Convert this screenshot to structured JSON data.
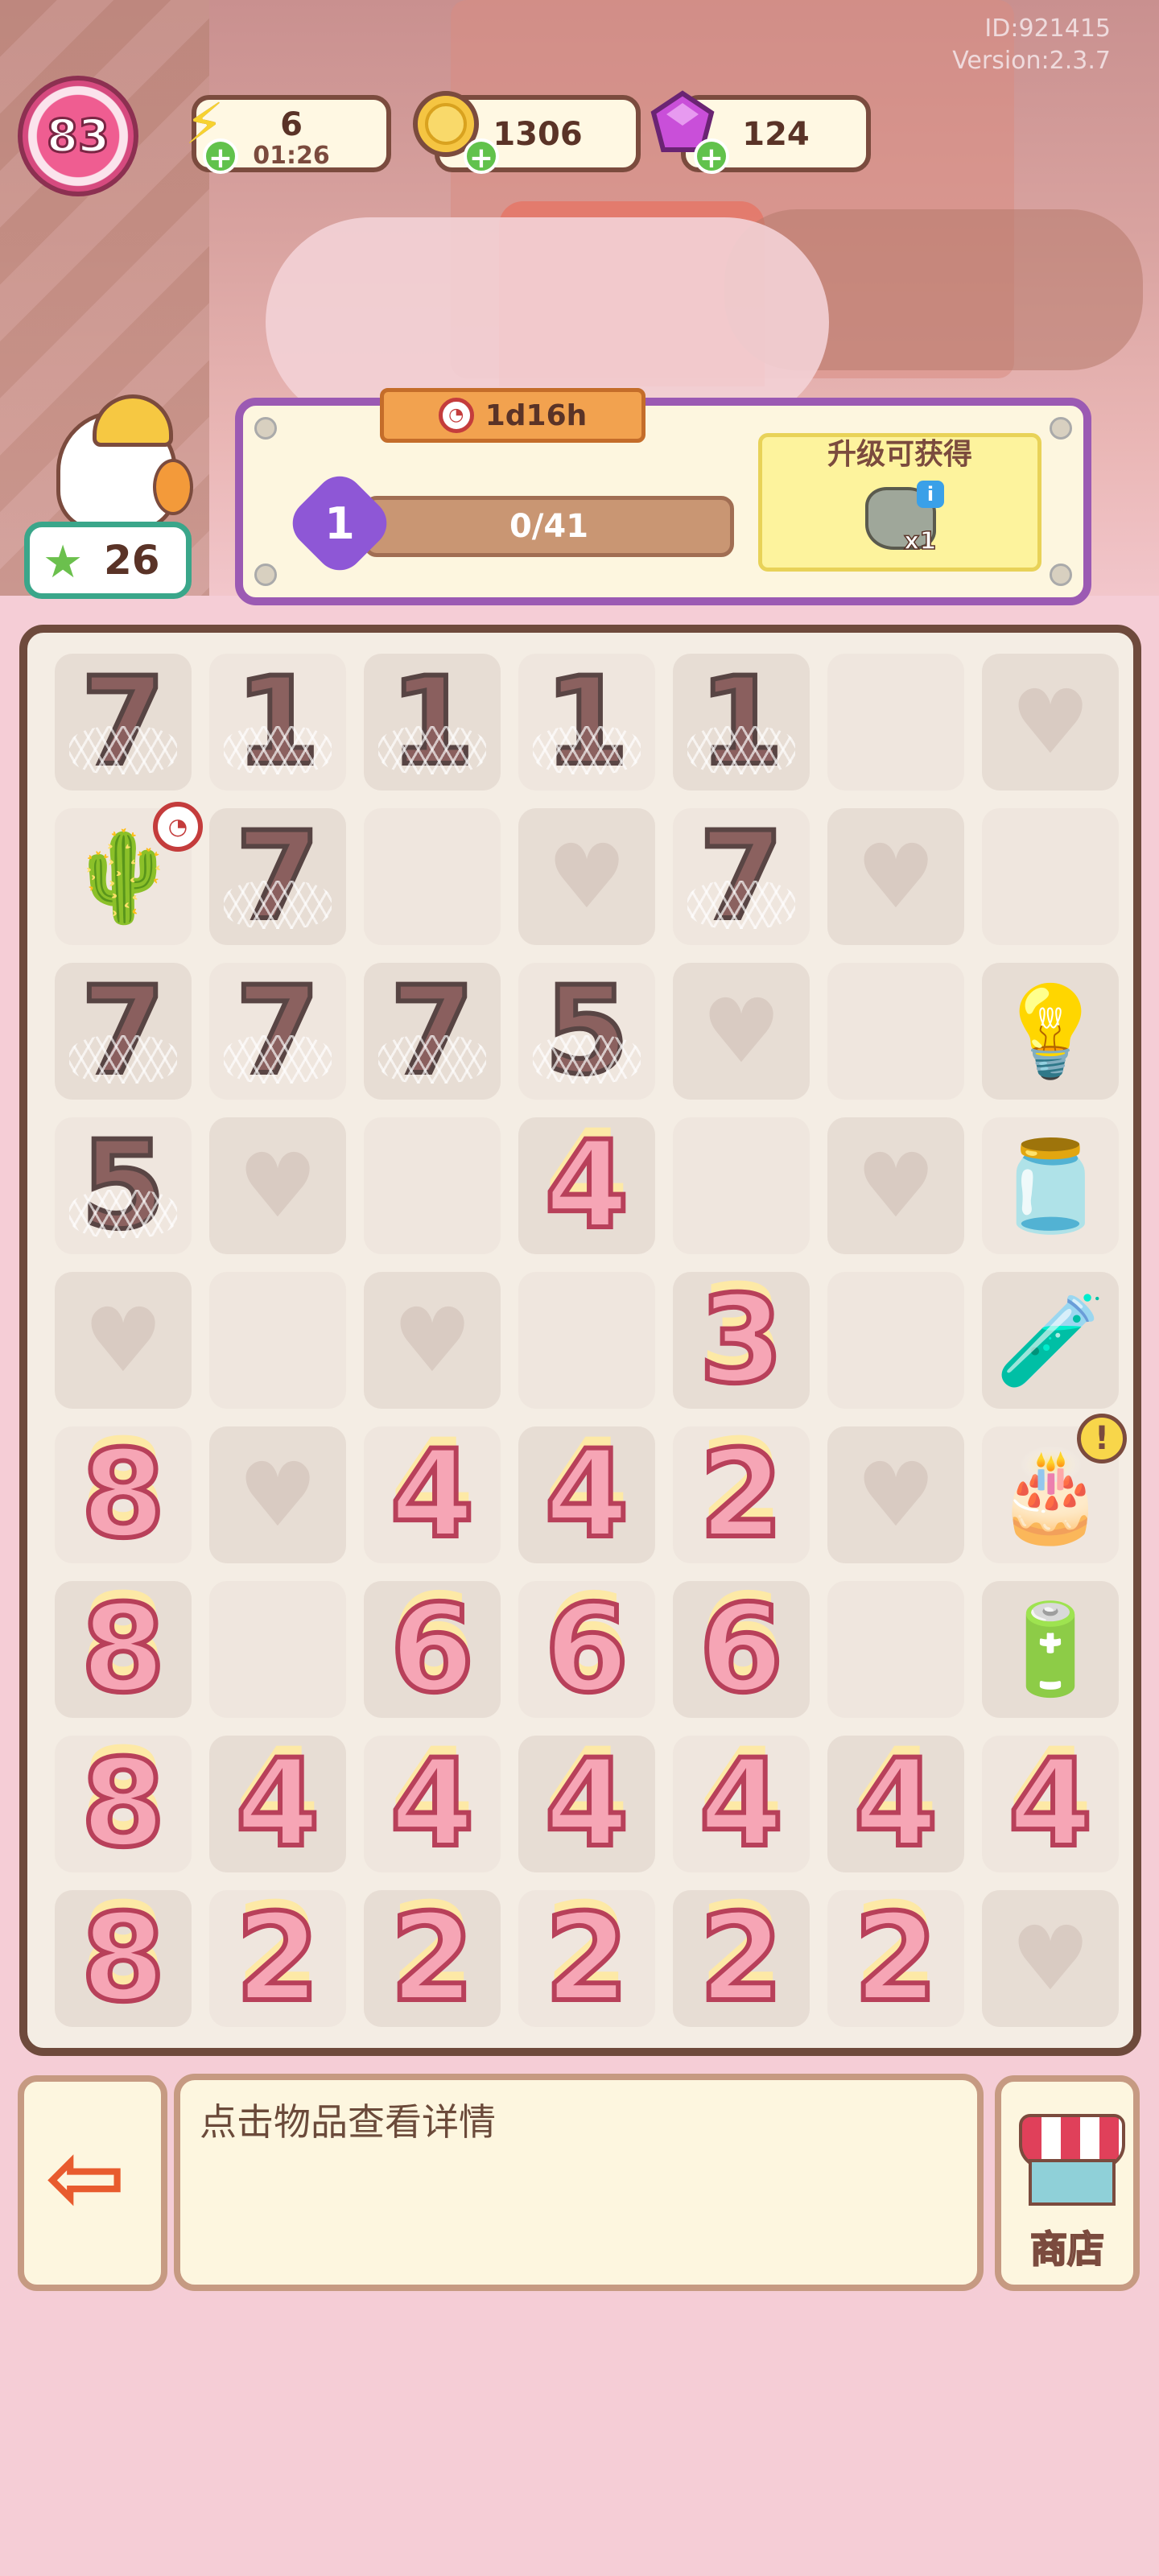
{
  "meta": {
    "id": "ID:921415",
    "version": "Version:2.3.7"
  },
  "hud": {
    "level": "83",
    "energy": {
      "value": "6",
      "timer": "01:26",
      "icon": "lightning-icon"
    },
    "coins": {
      "value": "1306",
      "icon": "coin-icon"
    },
    "gems": {
      "value": "124",
      "icon": "gem-icon"
    },
    "stars": {
      "value": "26",
      "icon": "clover-star-icon"
    }
  },
  "event_panel": {
    "time_left": "1d16h",
    "stage": "1",
    "progress_text": "0/41",
    "progress": 0.0,
    "reward_title": "升级可获得",
    "reward_qty": "x1",
    "reward_icon": "rock-icon"
  },
  "board": {
    "rows": [
      [
        {
          "t": "locked",
          "v": "7"
        },
        {
          "t": "locked",
          "v": "1"
        },
        {
          "t": "locked",
          "v": "1"
        },
        {
          "t": "locked",
          "v": "1"
        },
        {
          "t": "locked",
          "v": "1"
        },
        {
          "t": "empty"
        },
        {
          "t": "heart"
        }
      ],
      [
        {
          "t": "item",
          "icon": "cactus-pot-icon",
          "badge": "clock"
        },
        {
          "t": "locked",
          "v": "7"
        },
        {
          "t": "empty"
        },
        {
          "t": "heart"
        },
        {
          "t": "locked",
          "v": "7"
        },
        {
          "t": "heart"
        },
        {
          "t": "empty"
        }
      ],
      [
        {
          "t": "locked",
          "v": "7"
        },
        {
          "t": "locked",
          "v": "7"
        },
        {
          "t": "locked",
          "v": "7"
        },
        {
          "t": "locked",
          "v": "5"
        },
        {
          "t": "heart"
        },
        {
          "t": "empty"
        },
        {
          "t": "item",
          "icon": "bulb-bottle-icon"
        }
      ],
      [
        {
          "t": "locked",
          "v": "5"
        },
        {
          "t": "heart"
        },
        {
          "t": "empty"
        },
        {
          "t": "num",
          "v": "4"
        },
        {
          "t": "empty"
        },
        {
          "t": "heart"
        },
        {
          "t": "item",
          "icon": "star-jar-icon"
        }
      ],
      [
        {
          "t": "heart"
        },
        {
          "t": "empty"
        },
        {
          "t": "heart"
        },
        {
          "t": "empty"
        },
        {
          "t": "num",
          "v": "3"
        },
        {
          "t": "empty"
        },
        {
          "t": "item",
          "icon": "potion-vial-icon"
        }
      ],
      [
        {
          "t": "num",
          "v": "8"
        },
        {
          "t": "heart"
        },
        {
          "t": "num",
          "v": "4"
        },
        {
          "t": "num",
          "v": "4"
        },
        {
          "t": "num",
          "v": "2"
        },
        {
          "t": "heart"
        },
        {
          "t": "item",
          "icon": "cake-icon",
          "badge": "exclaim"
        }
      ],
      [
        {
          "t": "num",
          "v": "8"
        },
        {
          "t": "empty"
        },
        {
          "t": "num",
          "v": "6"
        },
        {
          "t": "num",
          "v": "6"
        },
        {
          "t": "num",
          "v": "6"
        },
        {
          "t": "empty"
        },
        {
          "t": "item",
          "icon": "battery-icon"
        }
      ],
      [
        {
          "t": "num",
          "v": "8"
        },
        {
          "t": "num",
          "v": "4"
        },
        {
          "t": "num",
          "v": "4"
        },
        {
          "t": "num",
          "v": "4"
        },
        {
          "t": "num",
          "v": "4"
        },
        {
          "t": "num",
          "v": "4"
        },
        {
          "t": "num",
          "v": "4"
        }
      ],
      [
        {
          "t": "num",
          "v": "8"
        },
        {
          "t": "num",
          "v": "2"
        },
        {
          "t": "num",
          "v": "2"
        },
        {
          "t": "num",
          "v": "2"
        },
        {
          "t": "num",
          "v": "2"
        },
        {
          "t": "num",
          "v": "2"
        },
        {
          "t": "heart"
        }
      ]
    ]
  },
  "footer": {
    "hint": "点击物品查看详情",
    "exit_icon": "exit-icon",
    "shop_label": "商店"
  },
  "colors": {
    "accent_purple": "#9b5ab3",
    "board_border": "#6e4a3c",
    "pink_number": "#f6a5b5",
    "background": "#f5cdd6"
  }
}
